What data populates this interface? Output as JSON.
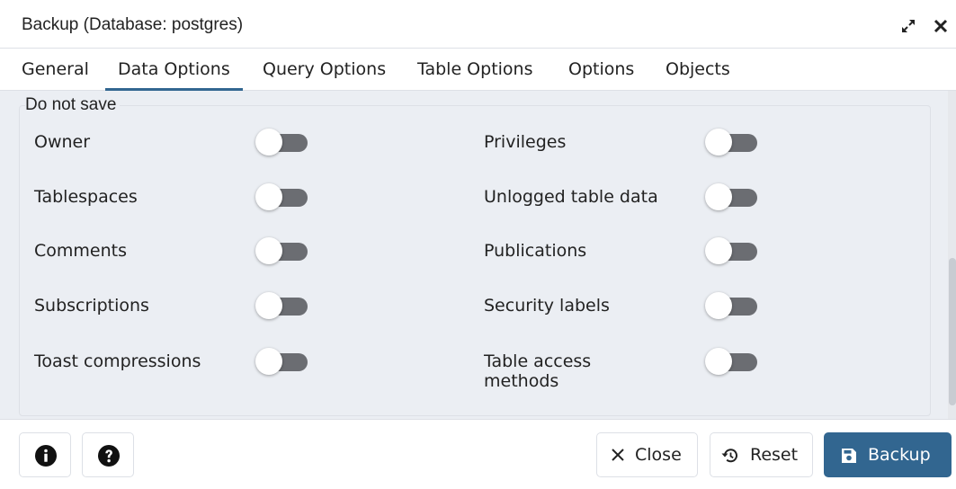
{
  "dialog": {
    "title": "Backup (Database: postgres)"
  },
  "tabs": [
    {
      "label": "General"
    },
    {
      "label": "Data Options"
    },
    {
      "label": "Query Options"
    },
    {
      "label": "Table Options"
    },
    {
      "label": "Options"
    },
    {
      "label": "Objects"
    }
  ],
  "active_tab": "Data Options",
  "section": {
    "legend": "Do not save",
    "left_options": [
      {
        "label": "Owner",
        "enabled": false
      },
      {
        "label": "Tablespaces",
        "enabled": false
      },
      {
        "label": "Comments",
        "enabled": false
      },
      {
        "label": "Subscriptions",
        "enabled": false
      },
      {
        "label": "Toast compressions",
        "enabled": false
      }
    ],
    "right_options": [
      {
        "label": "Privileges",
        "enabled": false
      },
      {
        "label": "Unlogged table data",
        "enabled": false
      },
      {
        "label": "Publications",
        "enabled": false
      },
      {
        "label": "Security labels",
        "enabled": false
      },
      {
        "label": "Table access methods",
        "enabled": false
      }
    ]
  },
  "footer": {
    "info_icon": "info-icon",
    "help_icon": "help-icon",
    "close_label": "Close",
    "reset_label": "Reset",
    "backup_label": "Backup"
  },
  "colors": {
    "accent": "#326690",
    "content_bg": "#ebeef3",
    "toggle_off": "#6b6d72"
  }
}
